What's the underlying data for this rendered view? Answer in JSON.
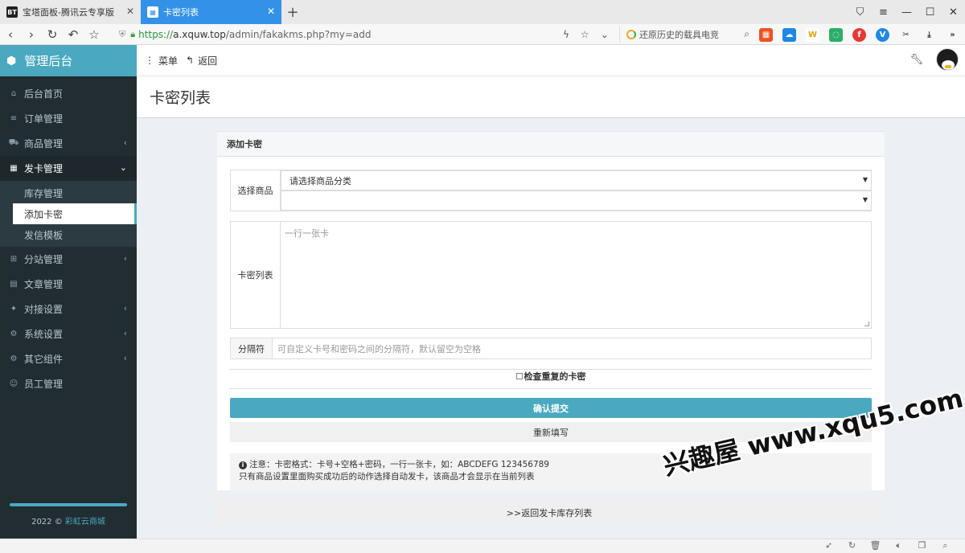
{
  "browser": {
    "tabs": [
      {
        "favicon": "BT",
        "title": "宝塔面板-腾讯云专享版",
        "active": false
      },
      {
        "favicon": "▦",
        "title": "卡密列表",
        "active": true
      }
    ],
    "url_scheme": "https://",
    "url_host": "a.xquw.top",
    "url_path": "/admin/fakakms.php?my=add",
    "search_text": "还原历史的载具电竞",
    "extensions": [
      {
        "name": "windows-icon",
        "color": "#f25022",
        "glyph": "▦"
      },
      {
        "name": "weather-icon",
        "color": "#1e88e5",
        "glyph": "☁"
      },
      {
        "name": "w-icon",
        "color": "#e6a400",
        "glyph": "W"
      },
      {
        "name": "wechat-icon",
        "color": "#2aae67",
        "glyph": "◌"
      },
      {
        "name": "f-icon",
        "color": "#e53935",
        "glyph": "f"
      },
      {
        "name": "v-icon",
        "color": "#1e88e5",
        "glyph": "V"
      }
    ]
  },
  "sidebar": {
    "brand": "管理后台",
    "menu": [
      {
        "name": "dashboard",
        "icon": "⌂",
        "label": "后台首页",
        "caret": false
      },
      {
        "name": "orders",
        "icon": "≡",
        "label": "订单管理",
        "caret": false
      },
      {
        "name": "products",
        "icon": "⛟",
        "label": "商品管理",
        "caret": true
      },
      {
        "name": "card-issue",
        "icon": "▦",
        "label": "发卡管理",
        "caret": true,
        "open": true
      },
      {
        "name": "branch",
        "icon": "⊞",
        "label": "分站管理",
        "caret": true
      },
      {
        "name": "articles",
        "icon": "▤",
        "label": "文章管理",
        "caret": false
      },
      {
        "name": "docking",
        "icon": "✦",
        "label": "对接设置",
        "caret": true
      },
      {
        "name": "system",
        "icon": "⚙",
        "label": "系统设置",
        "caret": true
      },
      {
        "name": "components",
        "icon": "⚙",
        "label": "其它组件",
        "caret": true
      },
      {
        "name": "staff",
        "icon": "☺",
        "label": "员工管理",
        "caret": false
      }
    ],
    "submenu": [
      {
        "label": "库存管理",
        "active": false
      },
      {
        "label": "添加卡密",
        "active": true
      },
      {
        "label": "发信模板",
        "active": false
      }
    ],
    "footer_year": "2022 ©",
    "footer_link": "彩虹云商城"
  },
  "topnav": {
    "menu_label": "菜单",
    "back_label": "返回"
  },
  "page_title": "卡密列表",
  "form": {
    "header": "添加卡密",
    "product_label": "选择商品",
    "category_placeholder": "请选择商品分类",
    "product_value": "",
    "cards_label": "卡密列表",
    "cards_placeholder": "一行一张卡",
    "separator_label": "分隔符",
    "separator_placeholder": "可自定义卡号和密码之间的分隔符，默认留空为空格",
    "check_duplicate": "检查重复的卡密",
    "submit": "确认提交",
    "reset": "重新填写",
    "note_line1": "注意：卡密格式：卡号+空格+密码，一行一张卡，如：ABCDEFG 123456789",
    "note_line2": "只有商品设置里面购买成功后的动作选择自动发卡，该商品才会显示在当前列表"
  },
  "back_link": ">>返回发卡库存列表",
  "watermark": "兴趣屋 www.xqu5.com"
}
